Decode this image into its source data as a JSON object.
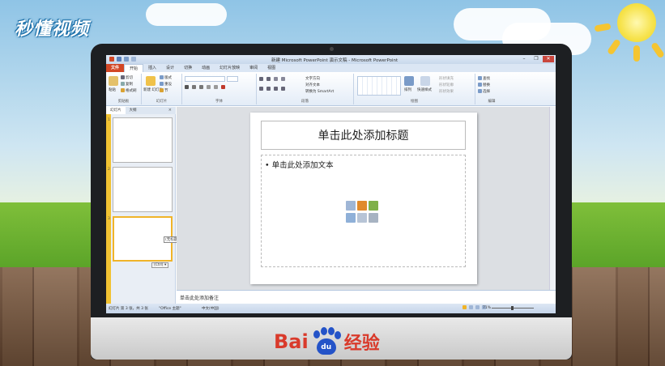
{
  "background": {
    "brand_logo": "秒懂视频",
    "watermark": {
      "brand_left": "Bai",
      "brand_paw": "du",
      "brand_right": "经验"
    }
  },
  "window": {
    "title": "新建 Microsoft PowerPoint 演示文稿 - Microsoft PowerPoint",
    "controls": {
      "minimize": "–",
      "restore": "❐",
      "close": "✕"
    }
  },
  "ribbon": {
    "tabs": [
      "文件",
      "开始",
      "插入",
      "设计",
      "切换",
      "动画",
      "幻灯片放映",
      "审阅",
      "视图"
    ],
    "groups": {
      "clipboard": {
        "label": "剪贴板",
        "paste": "粘贴",
        "cut": "剪切",
        "copy": "复制",
        "format_painter": "格式刷"
      },
      "slides": {
        "label": "幻灯片",
        "new_slide": "新建 幻灯片",
        "layout": "版式",
        "reset": "重设",
        "section": "节"
      },
      "font": {
        "label": "字体"
      },
      "paragraph": {
        "label": "段落",
        "text_direction": "文字方向",
        "align_text": "对齐文本",
        "smartart": "转换为 SmartArt"
      },
      "drawing": {
        "label": "绘图",
        "arrange": "排列",
        "quick_styles": "快速样式",
        "shape_fill": "形状填充",
        "shape_outline": "形状轮廓",
        "shape_effects": "形状效果"
      },
      "editing": {
        "label": "编辑",
        "find": "查找",
        "replace": "替换",
        "select": "选择"
      }
    }
  },
  "left_pane": {
    "tabs": [
      "幻灯片",
      "大纲"
    ],
    "close": "×",
    "slide_numbers": [
      "1",
      "2",
      "3"
    ],
    "tooltip": "(无标题)",
    "paste_options": "(Ctrl) ▾"
  },
  "slide": {
    "title_placeholder": "单击此处添加标题",
    "body_placeholder": "• 单击此处添加文本"
  },
  "notes": {
    "placeholder": "单击此处添加备注"
  },
  "status": {
    "slide_info": "幻灯片 第 3 张，共 3 张",
    "theme": "\"Office 主题\"",
    "language": "中文(中国)",
    "zoom": "71%"
  },
  "colors": {
    "file_tab": "#d24726",
    "selection_accent": "#f0b429",
    "baidu_red": "#d93a2b",
    "baidu_blue": "#2453c8"
  }
}
